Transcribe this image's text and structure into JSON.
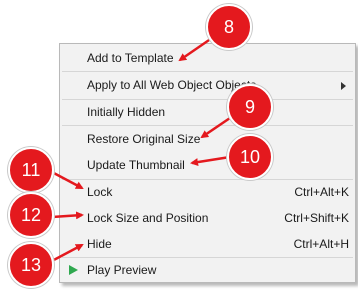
{
  "menu": {
    "items": [
      {
        "label": "Add to Template",
        "shortcut": ""
      },
      {
        "label": "Apply to All Web Object Objects",
        "shortcut": ""
      },
      {
        "label": "Initially Hidden",
        "shortcut": ""
      },
      {
        "label": "Restore Original Size",
        "shortcut": ""
      },
      {
        "label": "Update Thumbnail",
        "shortcut": ""
      },
      {
        "label": "Lock",
        "shortcut": "Ctrl+Alt+K"
      },
      {
        "label": "Lock Size and Position",
        "shortcut": "Ctrl+Shift+K"
      },
      {
        "label": "Hide",
        "shortcut": "Ctrl+Alt+H"
      },
      {
        "label": "Play Preview",
        "shortcut": ""
      }
    ],
    "submenu_icon": "chevron-right-icon",
    "play_icon": "play-icon",
    "play_icon_color": "#2fa84f"
  },
  "callouts": {
    "color": "#e4191e",
    "items": [
      {
        "number": "8"
      },
      {
        "number": "9"
      },
      {
        "number": "10"
      },
      {
        "number": "11"
      },
      {
        "number": "12"
      },
      {
        "number": "13"
      }
    ]
  }
}
